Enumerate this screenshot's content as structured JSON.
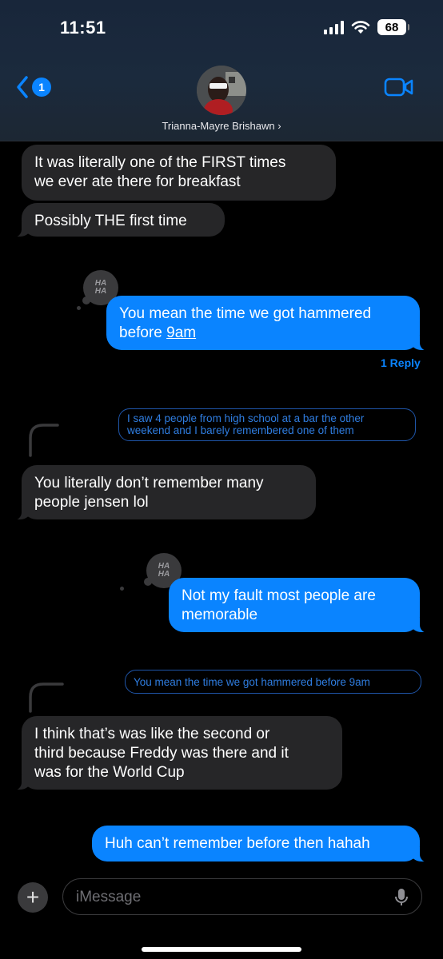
{
  "status_bar": {
    "time": "11:51",
    "battery": "68"
  },
  "header": {
    "back_badge": "1",
    "contact_name": "Trianna-Mayre Brishawn ›"
  },
  "messages": {
    "m1": "It was literally one of the FIRST times we ever ate there for breakfast",
    "m1_line1": "It was literally one of the FIRST times",
    "m1_line2": "we ever ate there for breakfast",
    "m2": "Possibly THE first time",
    "m3_line1": "You mean the time we got hammered",
    "m3_line2a": "before ",
    "m3_line2b": "9am",
    "m3_reply_count": "1 Reply",
    "q1_line1": "I saw 4 people from high school at a bar the other",
    "q1_line2": "weekend and I barely remembered one of them",
    "m4_line1": "You literally don’t remember many",
    "m4_line2": "people jensen lol",
    "m5_line1": "Not my fault most people are",
    "m5_line2": "memorable",
    "q2": "You mean the time we got hammered before 9am",
    "m6_line1": "I think that’s was like the second or",
    "m6_line2": "third because Freddy was there and it",
    "m6_line3": "was for the World Cup",
    "m7": "Huh can’t remember before then hahah"
  },
  "reactions": {
    "haha_top": "HA",
    "haha_bottom": "HA"
  },
  "composer": {
    "placeholder": "iMessage"
  },
  "colors": {
    "accent": "#0a84ff",
    "received_bubble": "#262628",
    "background": "#000000"
  }
}
